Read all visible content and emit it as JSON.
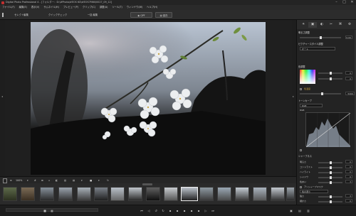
{
  "window": {
    "title": "Digital Photo Professional 4 - [フォルダー：D:\\#Photo\\#EOS 6D\\#EOS7M6II\\0027_09_12]"
  },
  "menu": [
    "ファイル(F)",
    "編集(E)",
    "表示(V)",
    "サムネイル(H)",
    "プレビュー(P)",
    "クリップ(C)",
    "調整(A)",
    "ツール(T)",
    "ウィンドウ(W)",
    "ヘルプ(H)"
  ],
  "toolbar": {
    "select_edit": "セレクト編集",
    "quick_check": "クイックチェック",
    "batch_edit": "一括 編集",
    "quick_label": "QPF",
    "save_label": "保存"
  },
  "viewer_bar": {
    "zoom": "100%"
  },
  "panel": {
    "tabs": [
      "☀",
      "▣",
      "◐",
      "✂",
      "⌘",
      "⚙"
    ],
    "brightness_label": "明るさ調整",
    "brightness_value": "0.00",
    "picture_style": "ピクチャースタイル調整",
    "style_value": "オート",
    "white_balance": "色調整",
    "wb_value": "オート",
    "color_temp_label": "色温度",
    "color_temp_value": "5200",
    "tone_label": "トーンカーブ",
    "mode_label": "モード",
    "curve_mode": "RGB",
    "rgb_label": "RGB",
    "brightness": "明るさ",
    "contrast": "コントラスト",
    "highlight": "ハイライト",
    "shadow": "シャドウ",
    "color_tone": "色あい",
    "saturation": "色の濃さ",
    "sharpness_label": "シャープネス",
    "sharpness_value": "3",
    "unsharp": "アンシャープマスク",
    "strength": "強さ",
    "fineness": "細かさ",
    "threshold": "しきい値",
    "values": [
      "0",
      "0",
      "0",
      "0",
      "0",
      "0",
      "3",
      "0",
      "0"
    ]
  },
  "colors": {
    "accent": "#3a7bd5",
    "panel_bg": "#232323",
    "viewer_bg": "#1f1f1f"
  }
}
